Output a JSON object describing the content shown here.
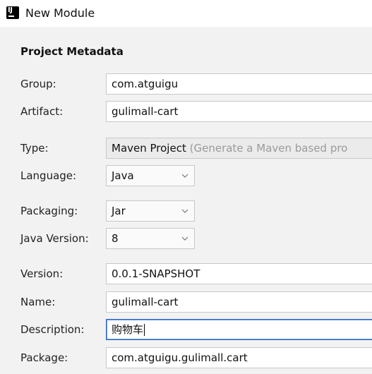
{
  "window": {
    "title": "New Module",
    "app_icon": "intellij-icon"
  },
  "section": {
    "title": "Project Metadata"
  },
  "fields": {
    "group": {
      "label": "Group:",
      "value": "com.atguigu"
    },
    "artifact": {
      "label": "Artifact:",
      "value": "gulimall-cart"
    },
    "type": {
      "label": "Type:",
      "value": "Maven Project",
      "hint": "(Generate a Maven based pro"
    },
    "language": {
      "label": "Language:",
      "value": "Java"
    },
    "packaging": {
      "label": "Packaging:",
      "value": "Jar"
    },
    "java_version": {
      "label": "Java Version:",
      "value": "8"
    },
    "version": {
      "label": "Version:",
      "value": "0.0.1-SNAPSHOT"
    },
    "name": {
      "label": "Name:",
      "value": "gulimall-cart"
    },
    "description": {
      "label": "Description:",
      "value": "购物车"
    },
    "package": {
      "label": "Package:",
      "value": "com.atguigu.gulimall.cart"
    }
  },
  "colors": {
    "focus": "#2f65ca",
    "hint": "#9a9a9a"
  }
}
